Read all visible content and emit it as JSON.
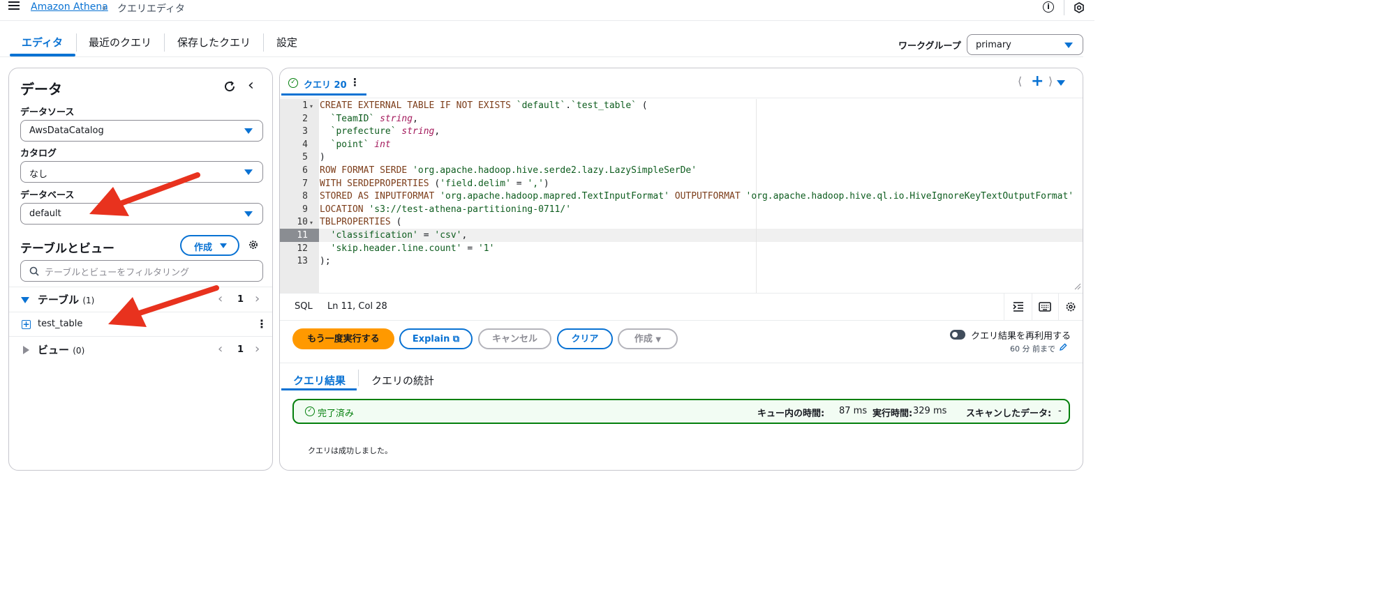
{
  "header": {
    "breadcrumb_root": "Amazon Athena",
    "breadcrumb_current": "クエリエディタ"
  },
  "main_tabs": [
    "エディタ",
    "最近のクエリ",
    "保存したクエリ",
    "設定"
  ],
  "workgroup": {
    "label": "ワークグループ",
    "value": "primary"
  },
  "data_panel": {
    "title": "データ",
    "datasource_label": "データソース",
    "datasource_value": "AwsDataCatalog",
    "catalog_label": "カタログ",
    "catalog_value": "なし",
    "database_label": "データベース",
    "database_value": "default",
    "tables_views_title": "テーブルとビュー",
    "create_button": "作成",
    "filter_placeholder": "テーブルとビューをフィルタリング",
    "tables_label": "テーブル",
    "tables_count": "(1)",
    "tables_page": "1",
    "table_items": [
      "test_table"
    ],
    "views_label": "ビュー",
    "views_count": "(0)",
    "views_page": "1"
  },
  "editor": {
    "query_tab": "クエリ 20",
    "line_numbers": [
      "1",
      "2",
      "3",
      "4",
      "5",
      "6",
      "7",
      "8",
      "9",
      "10",
      "11",
      "12",
      "13"
    ],
    "active_line": 11,
    "code_lines": [
      [
        [
          "kw",
          "CREATE EXTERNAL TABLE IF NOT EXISTS "
        ],
        [
          "str",
          "`default`"
        ],
        [
          "op",
          "."
        ],
        [
          "str",
          "`test_table`"
        ],
        [
          "op",
          " ("
        ]
      ],
      [
        [
          "op",
          "  "
        ],
        [
          "str",
          "`TeamID`"
        ],
        [
          "op",
          " "
        ],
        [
          "typ",
          "string"
        ],
        [
          "op",
          ","
        ]
      ],
      [
        [
          "op",
          "  "
        ],
        [
          "str",
          "`prefecture`"
        ],
        [
          "op",
          " "
        ],
        [
          "typ",
          "string"
        ],
        [
          "op",
          ","
        ]
      ],
      [
        [
          "op",
          "  "
        ],
        [
          "str",
          "`point`"
        ],
        [
          "op",
          " "
        ],
        [
          "typ",
          "int"
        ]
      ],
      [
        [
          "op",
          ")"
        ]
      ],
      [
        [
          "kw",
          "ROW FORMAT SERDE "
        ],
        [
          "str",
          "'org.apache.hadoop.hive.serde2.lazy.LazySimpleSerDe'"
        ]
      ],
      [
        [
          "kw",
          "WITH SERDEPROPERTIES "
        ],
        [
          "op",
          "("
        ],
        [
          "str",
          "'field.delim'"
        ],
        [
          "op",
          " = "
        ],
        [
          "str",
          "','"
        ],
        [
          "op",
          ")"
        ]
      ],
      [
        [
          "kw",
          "STORED AS INPUTFORMAT "
        ],
        [
          "str",
          "'org.apache.hadoop.mapred.TextInputFormat'"
        ],
        [
          "kw",
          " OUTPUTFORMAT "
        ],
        [
          "str",
          "'org.apache.hadoop.hive.ql.io.HiveIgnoreKeyTextOutputFormat'"
        ]
      ],
      [
        [
          "kw",
          "LOCATION "
        ],
        [
          "str",
          "'s3://test-athena-partitioning-0711/'"
        ]
      ],
      [
        [
          "kw",
          "TBLPROPERTIES "
        ],
        [
          "op",
          "("
        ]
      ],
      [
        [
          "op",
          "  "
        ],
        [
          "str",
          "'classification'"
        ],
        [
          "op",
          " = "
        ],
        [
          "str",
          "'csv'"
        ],
        [
          "op",
          ","
        ]
      ],
      [
        [
          "op",
          "  "
        ],
        [
          "str",
          "'skip.header.line.count'"
        ],
        [
          "op",
          " = "
        ],
        [
          "str",
          "'1'"
        ]
      ],
      [
        [
          "op",
          ");"
        ]
      ]
    ],
    "status_lang": "SQL",
    "status_position": "Ln 11, Col 28"
  },
  "actions": {
    "run_again": "もう一度実行する",
    "explain": "Explain",
    "cancel": "キャンセル",
    "clear": "クリア",
    "create": "作成",
    "reuse_label": "クエリ結果を再利用する",
    "reuse_sub": "60 分 前まで"
  },
  "results": {
    "tabs": [
      "クエリ結果",
      "クエリの統計"
    ],
    "status": "完了済み",
    "queue_time_label": "キュー内の時間:",
    "queue_time_value": "87 ms",
    "run_time_label": "実行時間:",
    "run_time_value": "329 ms",
    "scanned_label": "スキャンしたデータ:",
    "scanned_value": "-",
    "message": "クエリは成功しました。"
  },
  "colors": {
    "accent": "#0972d3",
    "primary_button": "#ff9900",
    "success": "#037f0c",
    "annotation_arrow": "#e8321e"
  }
}
